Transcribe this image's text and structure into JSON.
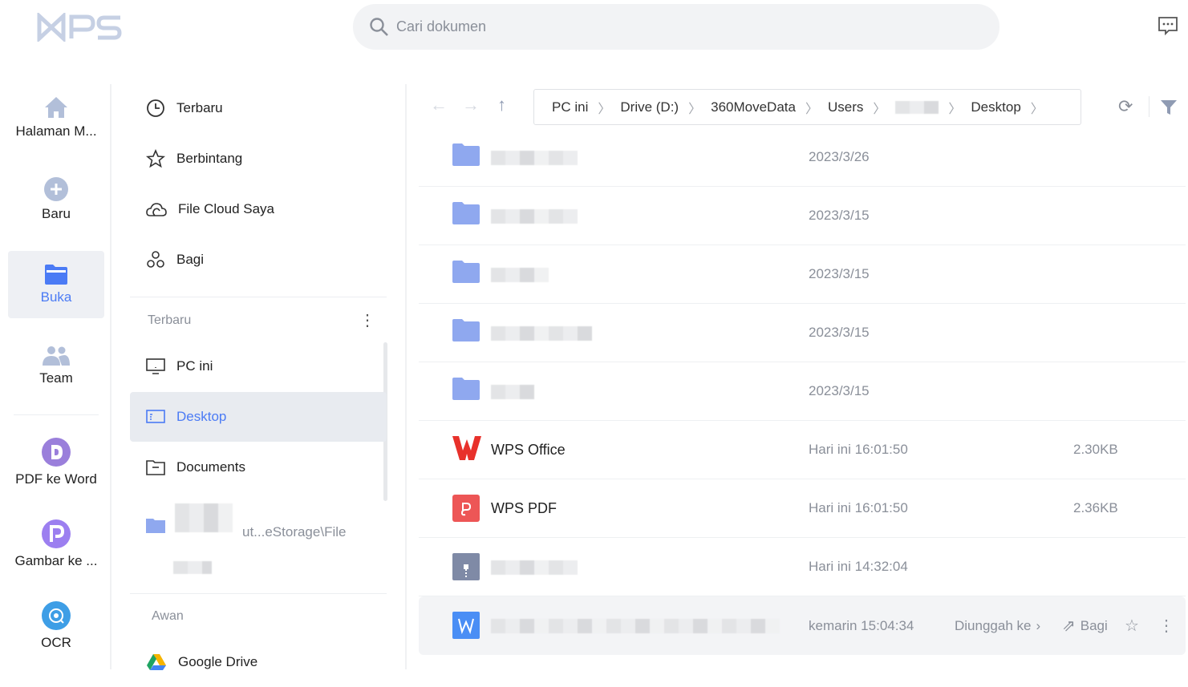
{
  "app": {
    "logo_text": "WPS",
    "search_placeholder": "Cari dokumen"
  },
  "nav": [
    {
      "label": "Halaman M...",
      "icon": "home-icon"
    },
    {
      "label": "Baru",
      "icon": "plus-circle-icon"
    },
    {
      "label": "Buka",
      "icon": "folder-icon",
      "active": true
    },
    {
      "label": "Team",
      "icon": "team-icon"
    },
    {
      "label": "PDF ke Word",
      "icon": "pdf-to-word-icon"
    },
    {
      "label": "Gambar ke ...",
      "icon": "image-to-pdf-icon"
    },
    {
      "label": "OCR",
      "icon": "ocr-icon"
    }
  ],
  "middle": {
    "quick": [
      "Terbaru",
      "Berbintang",
      "File Cloud Saya",
      "Bagi"
    ],
    "recent_header": "Terbaru",
    "locations": [
      "PC ini",
      "Desktop",
      "Documents"
    ],
    "recent_path": "ut...eStorage\\File",
    "cloud_header": "Awan",
    "cloud": [
      "Google Drive"
    ]
  },
  "breadcrumb": [
    "PC ini",
    "Drive (D:)",
    "360MoveData",
    "Users",
    "Desktop"
  ],
  "files": [
    {
      "type": "folder",
      "name": "",
      "date": "2023/3/26",
      "size": ""
    },
    {
      "type": "folder",
      "name": "",
      "date": "2023/3/15",
      "size": ""
    },
    {
      "type": "folder",
      "name": "",
      "date": "2023/3/15",
      "size": ""
    },
    {
      "type": "folder",
      "name": "",
      "date": "2023/3/15",
      "size": ""
    },
    {
      "type": "folder",
      "name": "",
      "date": "2023/3/15",
      "size": ""
    },
    {
      "type": "wps",
      "name": "WPS Office",
      "date": "Hari ini 16:01:50",
      "size": "2.30KB"
    },
    {
      "type": "pdf",
      "name": "WPS PDF",
      "date": "Hari ini 16:01:50",
      "size": "2.36KB"
    },
    {
      "type": "zip",
      "name": "",
      "date": "Hari ini 14:32:04",
      "size": ""
    },
    {
      "type": "word",
      "name": "",
      "date": "kemarin 15:04:34",
      "size": ""
    }
  ],
  "row_actions": {
    "upload": "Diunggah ke",
    "share": "Bagi"
  },
  "colors": {
    "accent": "#4b7bf5",
    "folder": "#8fa8ef"
  }
}
